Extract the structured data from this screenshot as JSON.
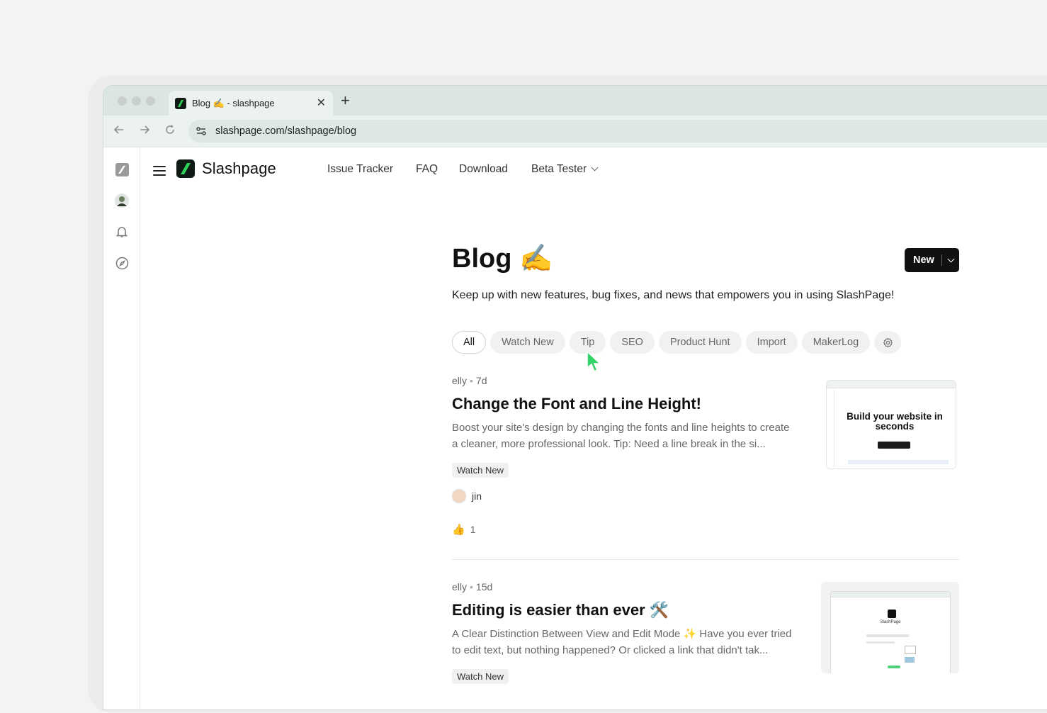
{
  "browser": {
    "tab_title": "Blog ✍️ - slashpage",
    "url": "slashpage.com/slashpage/blog"
  },
  "header": {
    "brand": "Slashpage",
    "nav": [
      "Issue Tracker",
      "FAQ",
      "Download",
      "Beta Tester"
    ]
  },
  "page": {
    "title": "Blog ✍️",
    "description": "Keep up with new features, bug fixes, and news that empowers you in using SlashPage!",
    "new_button": "New",
    "filters": [
      "All",
      "Watch New",
      "Tip",
      "SEO",
      "Product Hunt",
      "Import",
      "MakerLog"
    ],
    "active_filter": "All"
  },
  "posts": [
    {
      "author": "elly",
      "age": "7d",
      "title": "Change the Font and Line Height!",
      "excerpt": "Boost your site's design by changing the fonts and line heights to create a cleaner, more professional look. Tip: Need a line break in the si...",
      "tag": "Watch New",
      "assignee": "jin",
      "reaction_emoji": "👍",
      "reaction_count": "1",
      "thumb_heading": "Build your website in seconds"
    },
    {
      "author": "elly",
      "age": "15d",
      "title": "Editing is easier than ever 🛠️",
      "excerpt": "A Clear Distinction Between View and Edit Mode ✨ Have you ever tried to edit text, but nothing happened? Or clicked a link that didn't tak...",
      "tag": "Watch New",
      "thumb_heading": "SlashPage"
    }
  ],
  "colors": {
    "brand_green": "#2fd35c",
    "cursor_green": "#35d16a",
    "chrome_bar": "#dbe6e1"
  }
}
